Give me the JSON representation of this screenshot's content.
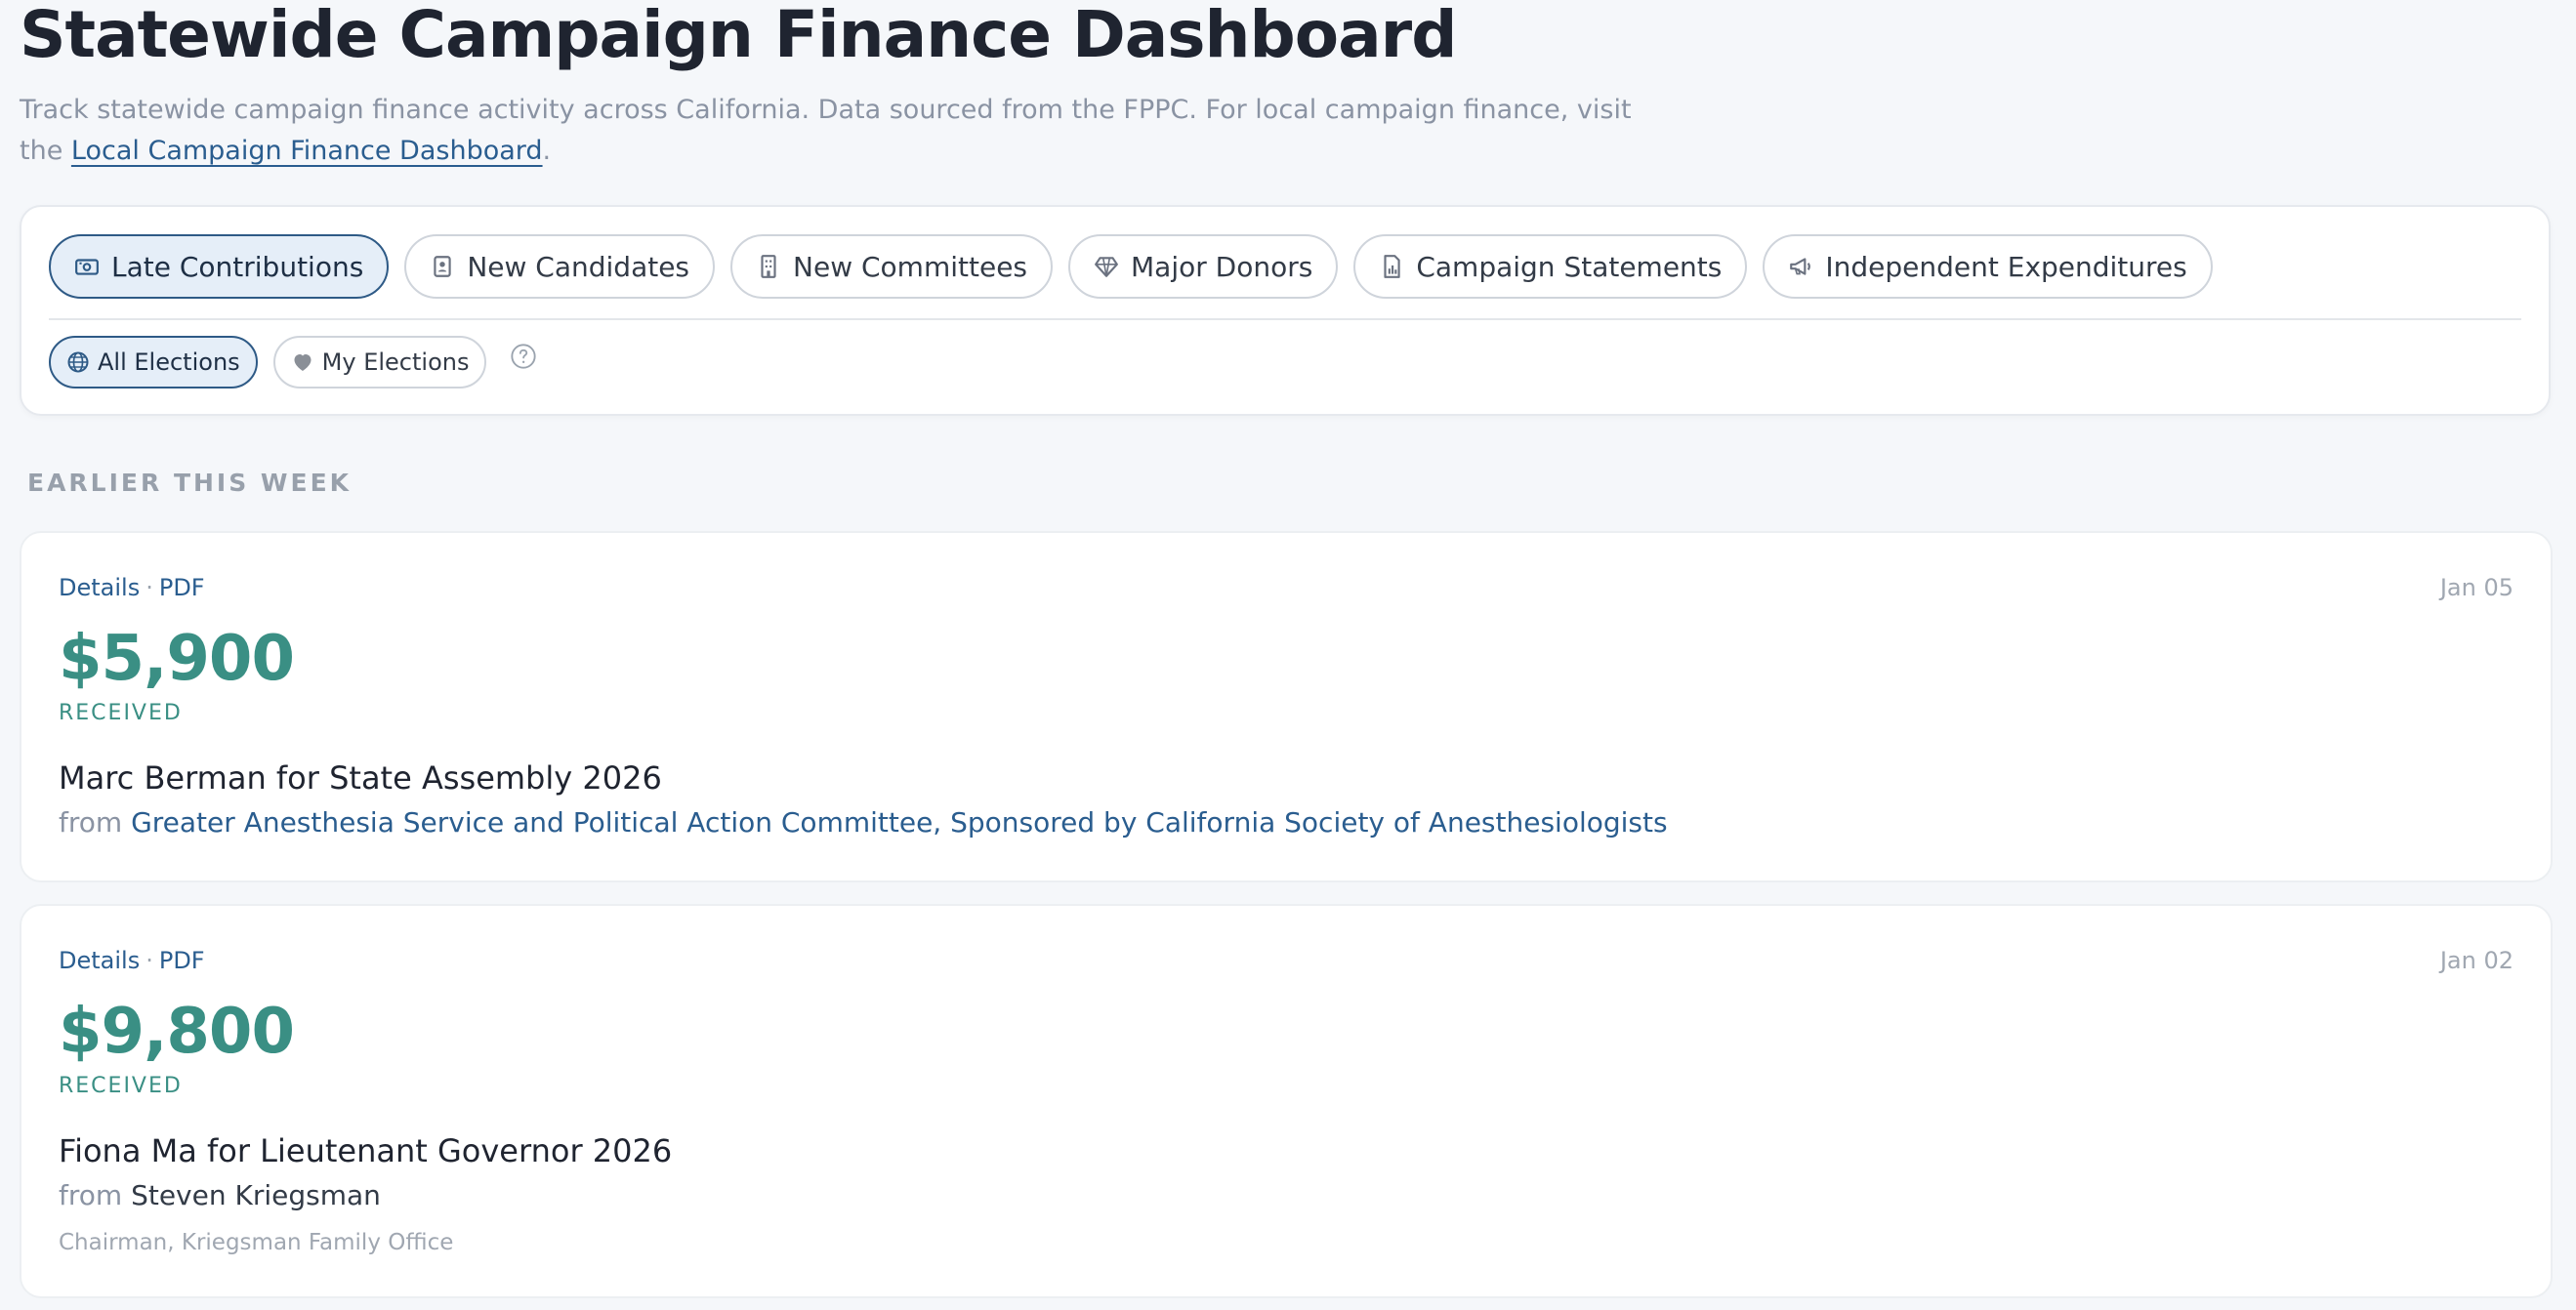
{
  "header": {
    "title": "Statewide Campaign Finance Dashboard",
    "subtitle_text": "Track statewide campaign finance activity across California. Data sourced from the FPPC. For local campaign finance, visit the ",
    "subtitle_link": "Local Campaign Finance Dashboard",
    "subtitle_end": "."
  },
  "tabs": [
    {
      "label": "Late Contributions",
      "icon": "cash-icon",
      "active": true
    },
    {
      "label": "New Candidates",
      "icon": "id-badge-icon",
      "active": false
    },
    {
      "label": "New Committees",
      "icon": "building-icon",
      "active": false
    },
    {
      "label": "Major Donors",
      "icon": "diamond-icon",
      "active": false
    },
    {
      "label": "Campaign Statements",
      "icon": "document-chart-icon",
      "active": false
    },
    {
      "label": "Independent Expenditures",
      "icon": "megaphone-icon",
      "active": false
    }
  ],
  "election_filters": [
    {
      "label": "All Elections",
      "icon": "globe-icon",
      "active": true
    },
    {
      "label": "My Elections",
      "icon": "heart-icon",
      "active": false
    }
  ],
  "section": {
    "label": "EARLIER THIS WEEK"
  },
  "cards": [
    {
      "details_label": "Details",
      "pdf_label": "PDF",
      "date": "Jan 05",
      "amount": "$5,900",
      "status": "RECEIVED",
      "recipient": "Marc Berman for State Assembly 2026",
      "from_label": "from",
      "donor": "Greater Anesthesia Service and Political Action Committee, Sponsored by California Society of Anesthesiologists",
      "donor_title": ""
    },
    {
      "details_label": "Details",
      "pdf_label": "PDF",
      "date": "Jan 02",
      "amount": "$9,800",
      "status": "RECEIVED",
      "recipient": "Fiona Ma for Lieutenant Governor 2026",
      "from_label": "from",
      "donor": "Steven Kriegsman",
      "donor_title": "Chairman, Kriegsman Family Office"
    }
  ],
  "colors": {
    "accent": "#2e5a86",
    "amount": "#3a8f84",
    "background": "#f5f7fa"
  }
}
